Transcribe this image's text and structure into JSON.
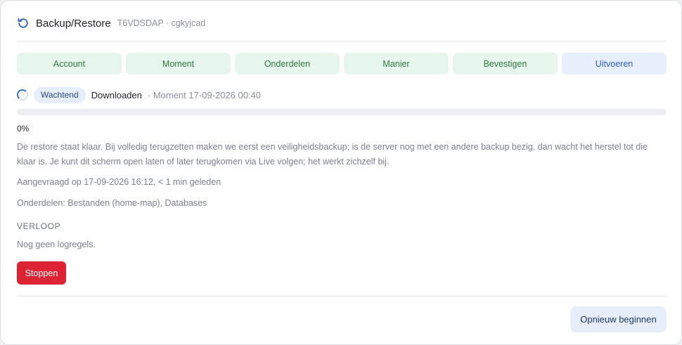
{
  "header": {
    "title": "Backup/Restore",
    "subtitle": "T6VDSDAP · cgkyjcad",
    "icon": "refresh-icon"
  },
  "steps": [
    {
      "label": "Account",
      "state": "done"
    },
    {
      "label": "Moment",
      "state": "done"
    },
    {
      "label": "Onderdelen",
      "state": "done"
    },
    {
      "label": "Manier",
      "state": "done"
    },
    {
      "label": "Bevestigen",
      "state": "done"
    },
    {
      "label": "Uitvoeren",
      "state": "current"
    }
  ],
  "status": {
    "badge": "Wachtend",
    "stage": "Downloaden",
    "moment": "· Moment 17-09-2026 00:40"
  },
  "progress": {
    "value": 0,
    "label": "0%"
  },
  "info_text": "De restore staat klaar. Bij volledig terugzetten maken we eerst een veiligheidsbackup; is de server nog met een andere backup bezig, dan wacht het herstel tot die klaar is. Je kunt dit scherm open laten of later terugkomen via Live volgen; het werkt zichzelf bij.",
  "requested": "Aangevraagd op 17-09-2026 16:12, < 1 min geleden",
  "parts": "Onderdelen: Bestanden (home-map), Databases",
  "log": {
    "title": "VERLOOP",
    "empty": "Nog geen logregels."
  },
  "buttons": {
    "stop": "Stoppen",
    "restart": "Opnieuw beginnen"
  },
  "colors": {
    "accent": "#3a6fd8",
    "done_bg": "#e7f6ec",
    "done_text": "#2e7d3f",
    "current_bg": "#e8effc",
    "current_text": "#2f5fcc",
    "danger": "#dc2434"
  }
}
